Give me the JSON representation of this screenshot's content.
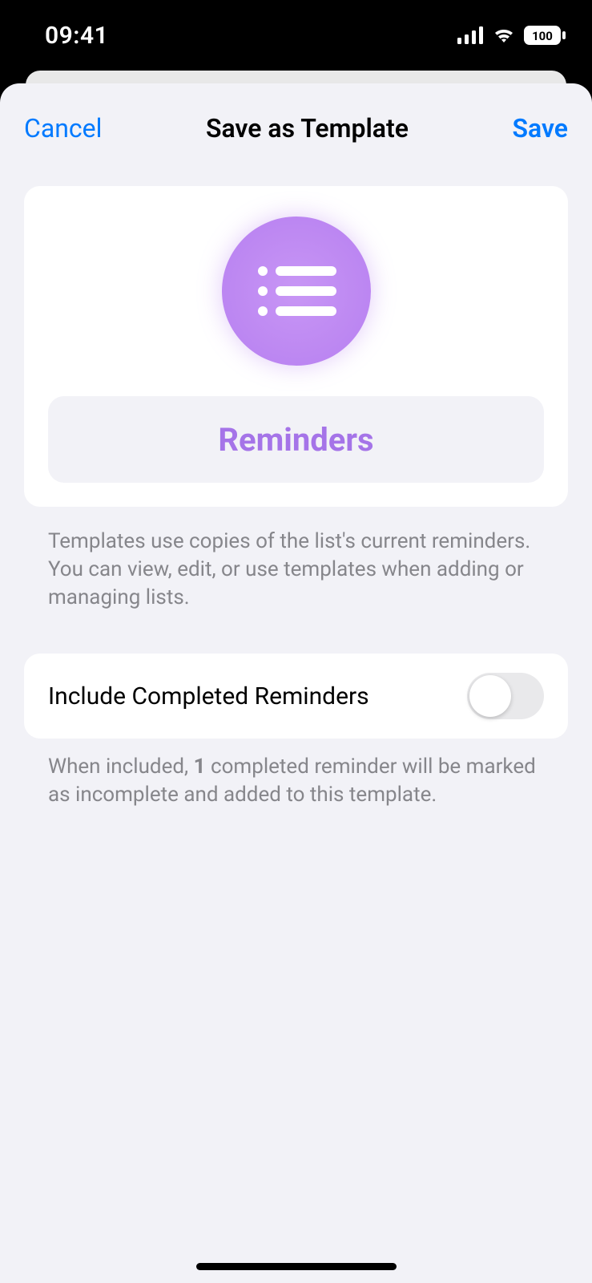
{
  "status_bar": {
    "time": "09:41",
    "battery": "100"
  },
  "sheet": {
    "cancel_label": "Cancel",
    "title": "Save as Template",
    "save_label": "Save"
  },
  "template": {
    "name": "Reminders",
    "icon_color": "#b67ff0",
    "description": "Templates use copies of the list's current reminders. You can view, edit, or use templates when adding or managing lists."
  },
  "option": {
    "include_completed_label": "Include Completed Reminders",
    "include_completed_value": false,
    "footer_prefix": "When included, ",
    "footer_count": "1",
    "footer_suffix": " completed reminder will be marked as incomplete and added to this template."
  }
}
